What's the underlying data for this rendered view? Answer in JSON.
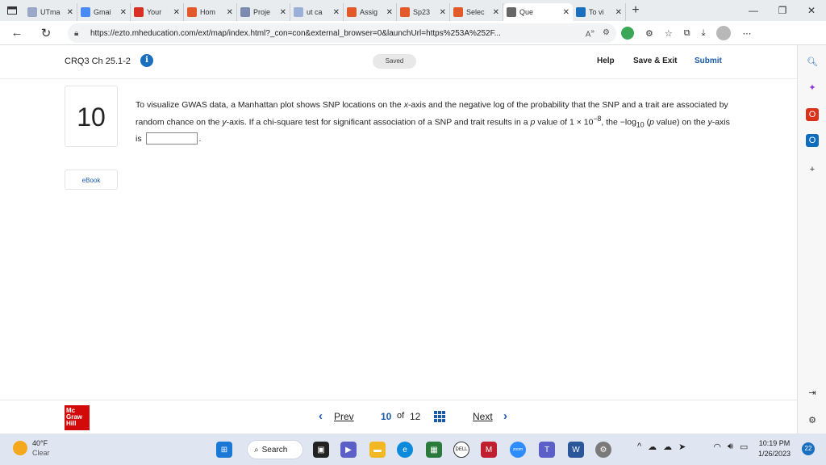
{
  "browser": {
    "tabs": [
      {
        "label": "UTma",
        "color": "#9aa8c8"
      },
      {
        "label": "Gmai",
        "color": "#4a8af4"
      },
      {
        "label": "Your",
        "color": "#d93025"
      },
      {
        "label": "Hom",
        "color": "#e2592a"
      },
      {
        "label": "Proje",
        "color": "#7b8cae"
      },
      {
        "label": "ut ca",
        "color": "#9ab0d6"
      },
      {
        "label": "Assig",
        "color": "#e2592a"
      },
      {
        "label": "Sp23",
        "color": "#e2592a"
      },
      {
        "label": "Selec",
        "color": "#e2592a"
      },
      {
        "label": "Que",
        "color": "#666666"
      },
      {
        "label": "To vi",
        "color": "#1a6fbf"
      }
    ],
    "url": "https://ezto.mheducation.com/ext/map/index.html?_con=con&external_browser=0&launchUrl=https%253A%252F..."
  },
  "header": {
    "assignment_title": "CRQ3 Ch 25.1-2",
    "info_label": "i",
    "saved_label": "Saved",
    "help_label": "Help",
    "save_exit_label": "Save & Exit",
    "submit_label": "Submit"
  },
  "question": {
    "number": "10",
    "text_part1": "To visualize GWAS data, a Manhattan plot shows SNP locations on the ",
    "x_axis": "x",
    "text_part2": "-axis and the negative log of the probability that the SNP and a trait are associated by random chance on the ",
    "y_axis": "y",
    "text_part3": "-axis. If a chi-square test for significant association of a SNP and trait results in a ",
    "p_letter": "p",
    "text_part4": " value of 1 × 10",
    "exponent": "−8",
    "text_part5": ", the −log",
    "log_sub": "10",
    "text_part6": " (",
    "p_letter2": "p",
    "text_part7": " value) on the ",
    "y_axis2": "y",
    "text_part8": "-axis is",
    "text_end": ".",
    "ebook_label": "eBook"
  },
  "footer": {
    "logo_lines": [
      "Mc",
      "Graw",
      "Hill"
    ],
    "prev_label": "Prev",
    "current_page": "10",
    "of_label": "of",
    "total_pages": "12",
    "next_label": "Next"
  },
  "taskbar": {
    "temperature": "40°F",
    "condition": "Clear",
    "search_label": "Search",
    "time": "10:19 PM",
    "date": "1/26/2023",
    "notification_count": "22"
  }
}
